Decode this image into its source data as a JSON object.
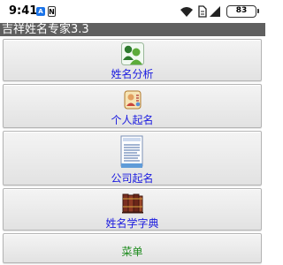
{
  "status_bar": {
    "time": "9:41",
    "notif_a": "A",
    "notif_n": "N",
    "battery": "83"
  },
  "app": {
    "title": "吉祥姓名专家3.3"
  },
  "menu": {
    "name_analysis": "姓名分析",
    "personal_naming": "个人起名",
    "company_naming": "公司起名",
    "name_dictionary": "姓名学字典",
    "menu": "菜单"
  },
  "colors": {
    "title_bar": "#606060",
    "label_blue": "#1a1adf",
    "label_green": "#1f8c1f"
  },
  "icons": {
    "name_analysis": "two-people-icon",
    "personal_naming": "person-scroll-icon",
    "company_naming": "document-icon",
    "name_dictionary": "books-icon"
  }
}
